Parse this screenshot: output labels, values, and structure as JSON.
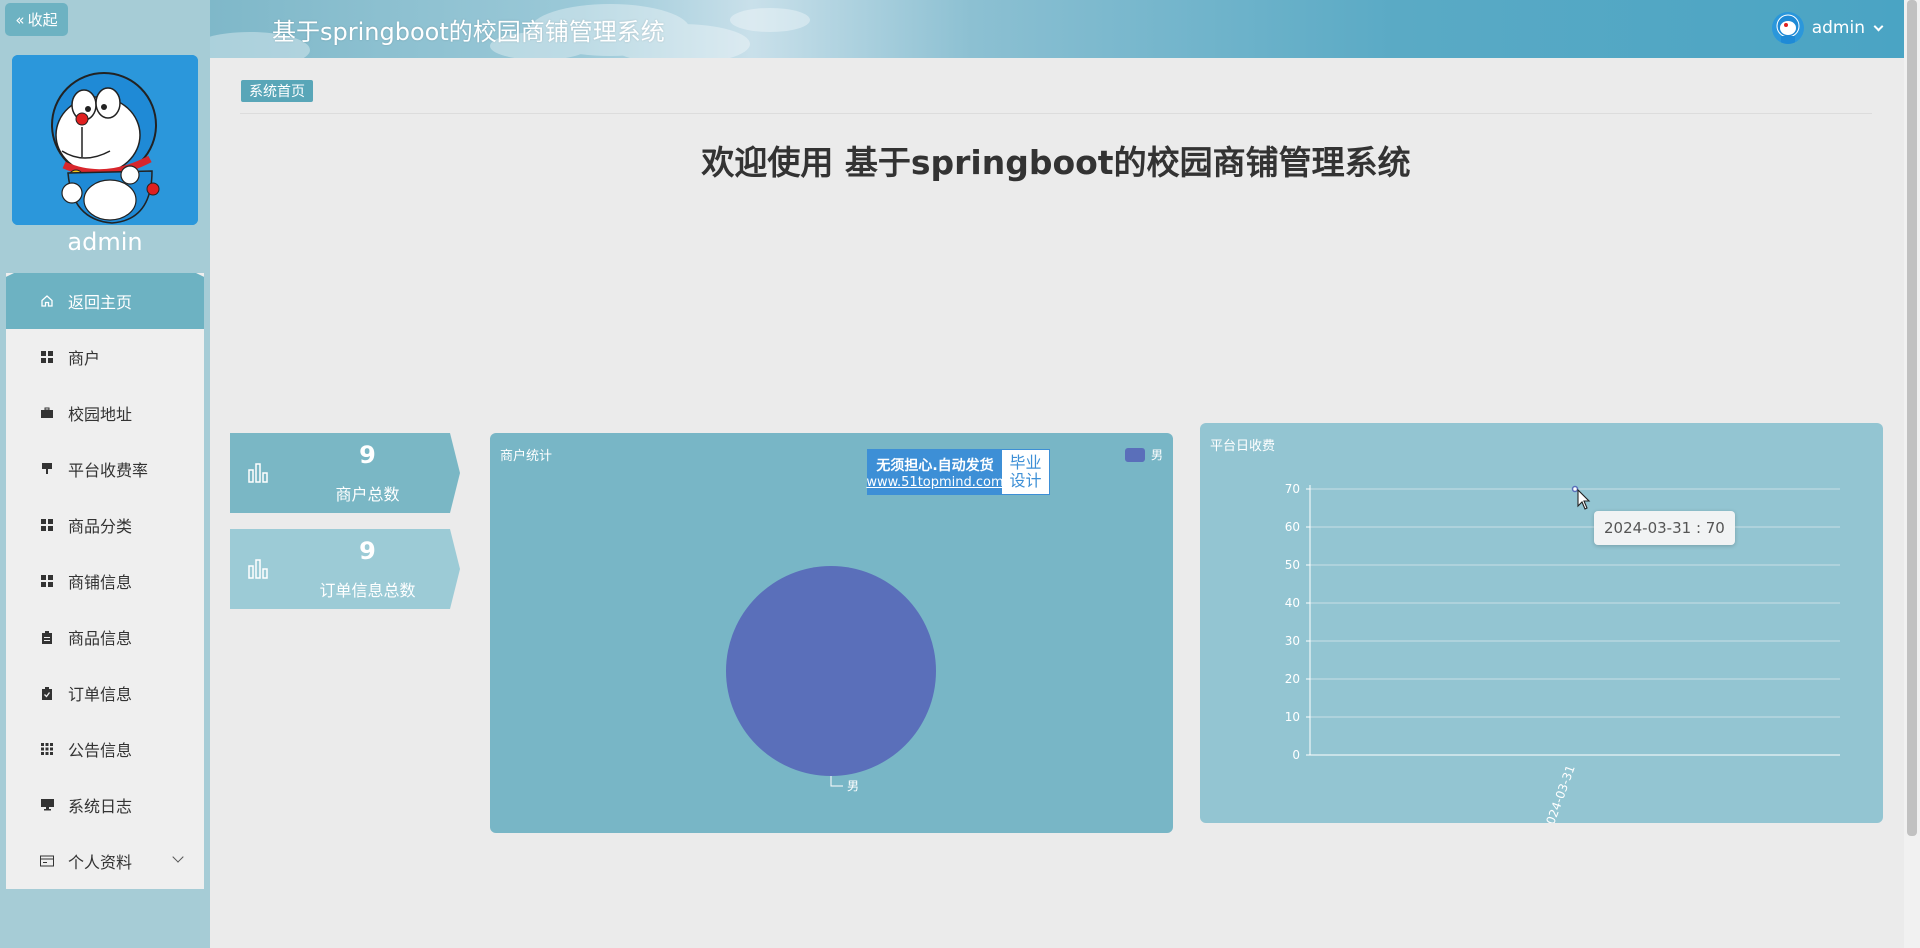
{
  "app": {
    "title": "基于springboot的校园商铺管理系统"
  },
  "sidebar": {
    "collapse_label": "收起",
    "username": "admin",
    "menu": [
      {
        "label": "返回主页",
        "icon": "home-icon",
        "active": true
      },
      {
        "label": "商户",
        "icon": "grid-icon"
      },
      {
        "label": "校园地址",
        "icon": "briefcase-icon"
      },
      {
        "label": "平台收费率",
        "icon": "stamp-icon"
      },
      {
        "label": "商品分类",
        "icon": "grid-icon"
      },
      {
        "label": "商铺信息",
        "icon": "grid-icon"
      },
      {
        "label": "商品信息",
        "icon": "clipboard-icon"
      },
      {
        "label": "订单信息",
        "icon": "clipboard-check-icon"
      },
      {
        "label": "公告信息",
        "icon": "apps-icon"
      },
      {
        "label": "系统日志",
        "icon": "monitor-icon"
      },
      {
        "label": "个人资料",
        "icon": "card-icon",
        "expandable": true
      }
    ]
  },
  "header": {
    "username": "admin"
  },
  "breadcrumb": "系统首页",
  "welcome": "欢迎使用 基于springboot的校园商铺管理系统",
  "stats": [
    {
      "value": "9",
      "label": "商户总数"
    },
    {
      "value": "9",
      "label": "订单信息总数"
    }
  ],
  "ad": {
    "line1": "无须担心.自动发货",
    "line2": "www.51topmind.com",
    "right1": "毕业",
    "right2": "设计"
  },
  "colors": {
    "accent": "#6db2c2",
    "pie_slice": "#5a6fba"
  },
  "chart_data": [
    {
      "type": "pie",
      "title": "商户统计",
      "legend": [
        "男"
      ],
      "legend_position": "top-right",
      "slices": [
        {
          "name": "男",
          "value": 9
        }
      ]
    },
    {
      "type": "line",
      "title": "平台日收费",
      "x": [
        "2024-03-31"
      ],
      "x_tick_label": "024-03-31",
      "series": [
        {
          "values": [
            70
          ]
        }
      ],
      "ylim": [
        0,
        70
      ],
      "yticks": [
        0,
        10,
        20,
        30,
        40,
        50,
        60,
        70
      ],
      "grid": true,
      "tooltip": "2024-03-31 : 70"
    }
  ]
}
